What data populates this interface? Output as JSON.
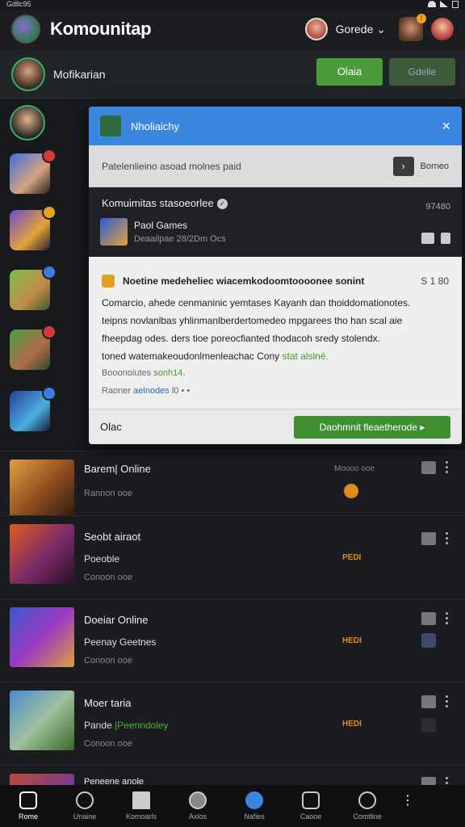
{
  "status": {
    "left": "Gdllc95"
  },
  "header": {
    "title": "Komounitap",
    "user": "Gorede",
    "notif_count": "!"
  },
  "subheader": {
    "title": "Mofikarian",
    "btn_primary": "Olaia",
    "btn_secondary": "Gdelle"
  },
  "rail_badges": [
    "",
    "",
    "",
    "",
    ""
  ],
  "modal": {
    "title": "Nholiaichy",
    "close": "×",
    "search_text": "Patelenlieino asoad molnes paid",
    "search_label": "Borneo",
    "community": {
      "title": "Komuimitas stasoeorlee",
      "count": "97480",
      "item_name": "Paol Games",
      "item_sub": "Deaailpae 28/2Dm Ocs"
    },
    "notice_title": "Noetine medeheliec wiacemkodoomtoooonee sonint",
    "notice_num": "S 1 80",
    "body_lines": [
      "Comarcio, ahede cenmaninic yemtases Kayanh dan thoiddomationotes.",
      "teipns novlanlbas yhlinmanlberdertomedeo mpgarees tho han scal aie",
      "fheepdag odes. ders tioe poreocfianted thodacoh sredy stolendx.",
      "toned watemakeoudonlmenleachac Cony"
    ],
    "body_green": "stat alslné.",
    "meta_line1": "Booonoiutes",
    "meta_line1_green": "sonh14.",
    "meta_line2": "Raoner",
    "meta_line2_link": "aelnodes",
    "meta_line2_rest": "l0  • •",
    "footer_label": "Olac",
    "footer_button": "Daohmnit fleaetherode ▸"
  },
  "rows": [
    {
      "title": "Barem| Online",
      "sub": "",
      "meta": "Rannon ooe",
      "right_meta": "Moooo ooe",
      "tag": ""
    },
    {
      "title": "Seobt airaot",
      "sub": "Poeoble",
      "meta": "Conoon ooe",
      "right_meta": "",
      "tag": "PEDI"
    },
    {
      "title": "Doeiar Online",
      "sub": "Peenay Geetnes",
      "meta": "Conoon ooe",
      "right_meta": "",
      "tag": "HEDI"
    },
    {
      "title": "Moer taria",
      "sub": "Pande",
      "sub_green": "Peenndoley",
      "meta": "Conoon ooe",
      "right_meta": "",
      "tag": "HEDI"
    },
    {
      "title": "Peneene anole",
      "sub": "",
      "meta": "",
      "right_meta": "",
      "tag": ""
    }
  ],
  "nav": [
    {
      "label": "Rome",
      "icon": "home-square-icon"
    },
    {
      "label": "Unaine",
      "icon": "search-icon"
    },
    {
      "label": "Komoarls",
      "icon": "house-icon"
    },
    {
      "label": "Axlos",
      "icon": "ball-icon"
    },
    {
      "label": "Nafies",
      "icon": "globe-icon"
    },
    {
      "label": "Caooe",
      "icon": "dice-icon"
    },
    {
      "label": "Comtline",
      "icon": "clock-icon"
    }
  ]
}
